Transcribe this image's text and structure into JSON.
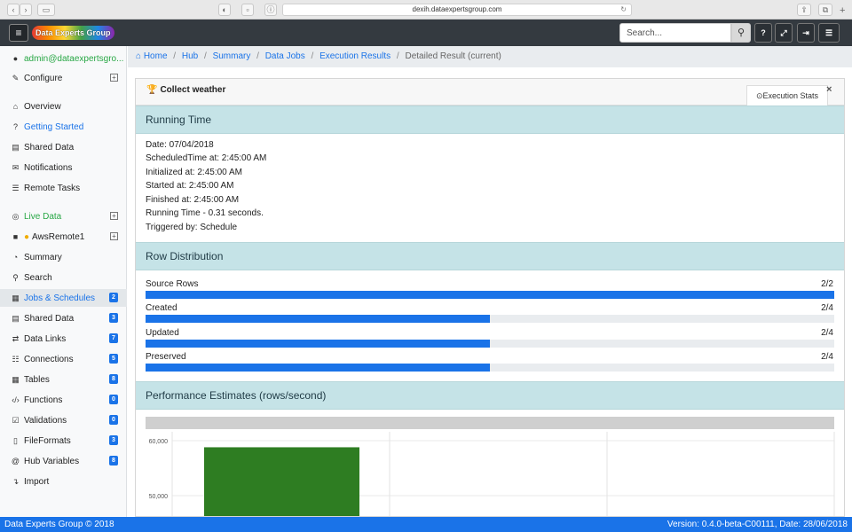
{
  "browser": {
    "url": "dexih.dataexpertsgroup.com"
  },
  "header": {
    "logo_text": "Data Experts Group",
    "search_placeholder": "Search...",
    "help_label": "?"
  },
  "sidebar": {
    "user": "admin@dataexpertsgro...",
    "configure": "Configure",
    "overview": "Overview",
    "getting_started": "Getting Started",
    "shared_data": "Shared Data",
    "notifications": "Notifications",
    "remote_tasks": "Remote Tasks",
    "live_data": "Live Data",
    "aws_remote": "AwsRemote1",
    "summary": "Summary",
    "search": "Search",
    "jobs": {
      "label": "Jobs & Schedules",
      "count": "2"
    },
    "hub_shared": {
      "label": "Shared Data",
      "count": "3"
    },
    "data_links": {
      "label": "Data Links",
      "count": "7"
    },
    "connections": {
      "label": "Connections",
      "count": "5"
    },
    "tables": {
      "label": "Tables",
      "count": "8"
    },
    "functions": {
      "label": "Functions",
      "count": "0"
    },
    "validations": {
      "label": "Validations",
      "count": "0"
    },
    "file_formats": {
      "label": "FileFormats",
      "count": "3"
    },
    "hub_variables": {
      "label": "Hub Variables",
      "count": "8"
    },
    "import": "Import"
  },
  "breadcrumb": {
    "home": "Home",
    "hub": "Hub",
    "summary": "Summary",
    "data_jobs": "Data Jobs",
    "execution_results": "Execution Results",
    "current": "Detailed Result (current)"
  },
  "panel": {
    "title": "Collect weather",
    "stats_tab": "Execution Stats",
    "close": "×"
  },
  "running_time": {
    "heading": "Running Time",
    "lines": [
      "Date: 07/04/2018",
      "ScheduledTime at: 2:45:00 AM",
      "Initialized at: 2:45:00 AM",
      "Started at: 2:45:00 AM",
      "Finished at: 2:45:00 AM",
      "Running Time - 0.31 seconds.",
      "Triggered by: Schedule"
    ]
  },
  "row_distribution": {
    "heading": "Row Distribution",
    "rows": [
      {
        "label": "Source Rows",
        "ratio": "2/2",
        "fraction": 1.0
      },
      {
        "label": "Created",
        "ratio": "2/4",
        "fraction": 0.5
      },
      {
        "label": "Updated",
        "ratio": "2/4",
        "fraction": 0.5
      },
      {
        "label": "Preserved",
        "ratio": "2/4",
        "fraction": 0.5
      }
    ]
  },
  "performance": {
    "heading": "Performance Estimates (rows/second)"
  },
  "chart_data": {
    "type": "bar",
    "categories": [
      ""
    ],
    "values": [
      58800
    ],
    "y_ticks": [
      "60,000",
      "50,000"
    ],
    "y_tick_values": [
      60000,
      50000
    ],
    "bar_color": "#2e7d22",
    "grid": true
  },
  "footer": {
    "left": "Data Experts Group © 2018",
    "right": "Version: 0.4.0-beta-C00111, Date: 28/06/2018"
  },
  "colors": {
    "accent": "#1a73e8",
    "section_bg": "#c5e3e7",
    "header_bg": "#343a40",
    "success": "#28a745"
  }
}
